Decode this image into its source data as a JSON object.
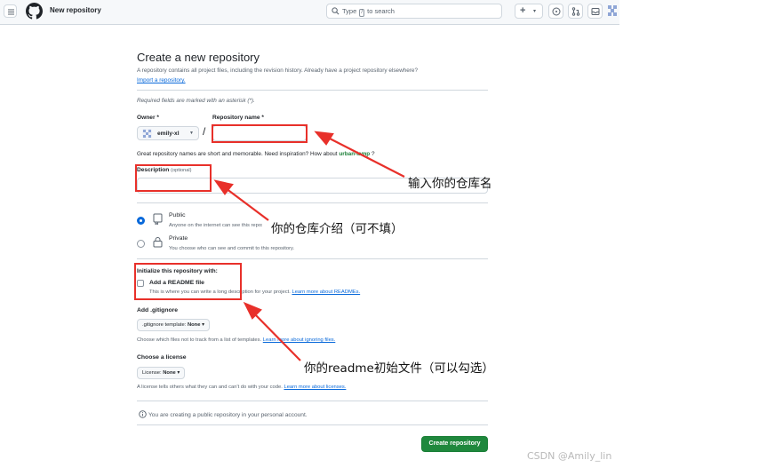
{
  "header": {
    "title": "New repository",
    "search_prefix": "Type",
    "search_key": "/",
    "search_suffix": "to search"
  },
  "page": {
    "title": "Create a new repository",
    "lead": "A repository contains all project files, including the revision history. Already have a project repository elsewhere?",
    "import_link": "Import a repository.",
    "required_note": "Required fields are marked with an asterisk (*)."
  },
  "form": {
    "owner_label": "Owner *",
    "owner_value": "emily-xl",
    "slash": "/",
    "repo_name_label": "Repository name *",
    "repo_name_value": "",
    "name_hint_prefix": "Great repository names are short and memorable. Need inspiration? How about",
    "name_suggestion": "urban-lamp",
    "name_hint_suffix": "?",
    "description_label": "Description",
    "description_optional": "(optional)",
    "description_value": "",
    "visibility": {
      "selected": "Public",
      "public_title": "Public",
      "public_desc": "Anyone on the internet can see this repository. You choose who can commit.",
      "private_title": "Private",
      "private_desc": "You choose who can see and commit to this repository."
    },
    "init_title": "Initialize this repository with:",
    "readme_checked": false,
    "readme_label": "Add a README file",
    "readme_desc": "This is where you can write a long description for your project.",
    "readme_link": "Learn more about READMEs.",
    "gitignore_title": "Add .gitignore",
    "gitignore_select_prefix": ".gitignore template:",
    "gitignore_select_value": "None",
    "gitignore_hint": "Choose which files not to track from a list of templates.",
    "gitignore_link": "Learn more about ignoring files.",
    "license_title": "Choose a license",
    "license_select_prefix": "License:",
    "license_select_value": "None",
    "license_hint": "A license tells others what they can and can't do with your code.",
    "license_link": "Learn more about licenses.",
    "info_line": "You are creating a public repository in your personal account.",
    "create_button": "Create repository"
  },
  "annotations": {
    "repo_name_note": "输入你的仓库名",
    "description_note": "你的仓库介绍（可不填）",
    "readme_note": "你的readme初始文件（可以勾选）",
    "color": "#e8302a"
  },
  "watermark": "CSDN @Amily_lin",
  "icons": [
    "menu-icon",
    "github-logo-icon",
    "search-icon",
    "plus-icon",
    "issue-icon",
    "pull-request-icon",
    "inbox-icon",
    "repo-icon",
    "lock-icon",
    "info-icon"
  ]
}
